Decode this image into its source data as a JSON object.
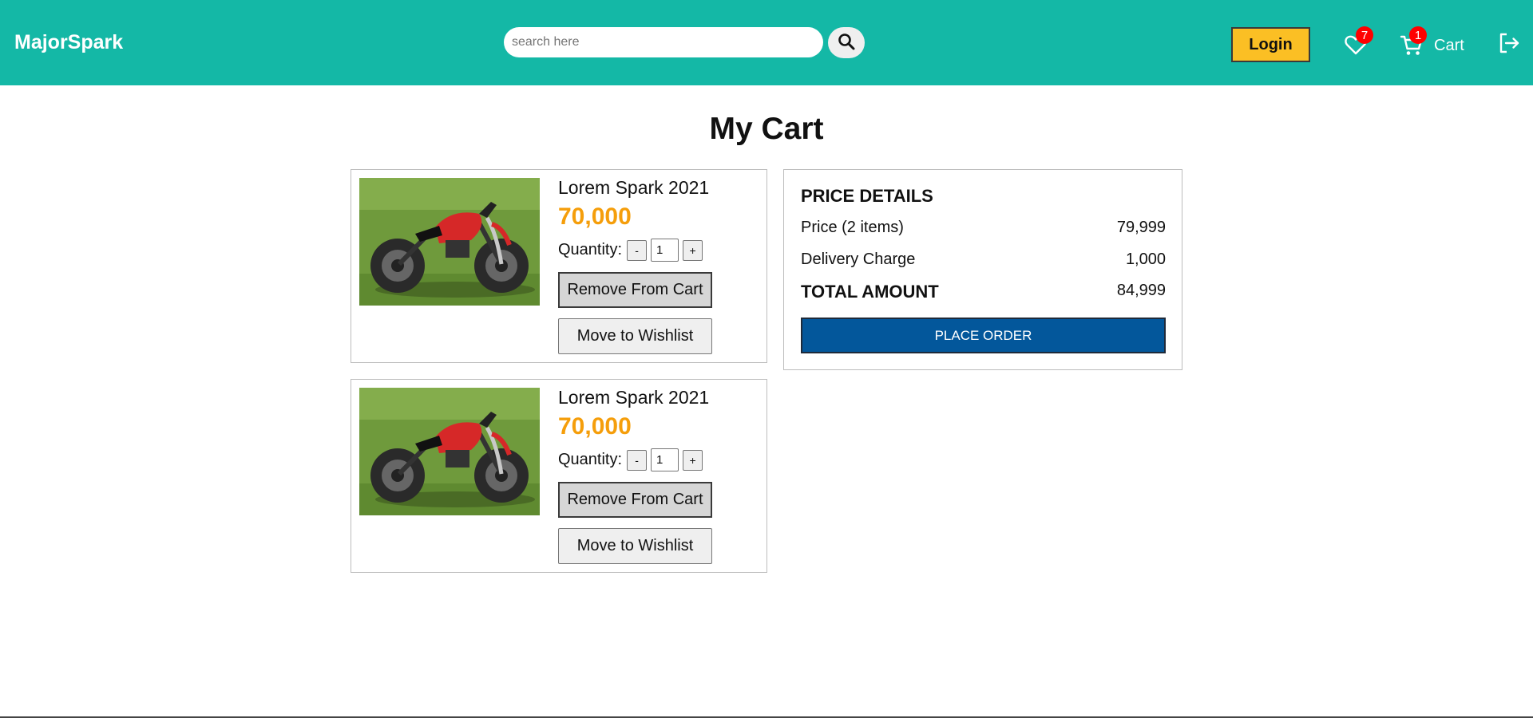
{
  "header": {
    "brand": "MajorSpark",
    "search_placeholder": "search here",
    "search_icon": "search-icon",
    "login_label": "Login",
    "wishlist_icon": "heart-icon",
    "wishlist_count": "7",
    "cart_icon": "cart-icon",
    "cart_count": "1",
    "cart_label": "Cart",
    "logout_icon": "logout-icon"
  },
  "page": {
    "title": "My Cart"
  },
  "cart": {
    "items": [
      {
        "image": "red-motorcycle-image",
        "name": "Lorem Spark 2021",
        "price": "70,000",
        "quantity_label": "Quantity:",
        "decrement_label": "-",
        "quantity": "1",
        "increment_label": "+",
        "remove_label": "Remove From Cart",
        "wishlist_label": "Move to Wishlist"
      },
      {
        "image": "red-motorcycle-image",
        "name": "Lorem Spark 2021",
        "price": "70,000",
        "quantity_label": "Quantity:",
        "decrement_label": "-",
        "quantity": "1",
        "increment_label": "+",
        "remove_label": "Remove From Cart",
        "wishlist_label": "Move to Wishlist"
      }
    ]
  },
  "price_details": {
    "heading": "PRICE DETAILS",
    "price_label": "Price (2 items)",
    "price_value": "79,999",
    "delivery_label": "Delivery Charge",
    "delivery_value": "1,000",
    "total_label": "TOTAL AMOUNT",
    "total_value": "84,999",
    "place_order_label": "PLACE ORDER"
  },
  "colors": {
    "navbar": "#14b8a6",
    "login_button": "#fbbf24",
    "price_text": "#f59e0b",
    "place_order_button": "#03579b",
    "badge": "#ff0000"
  }
}
